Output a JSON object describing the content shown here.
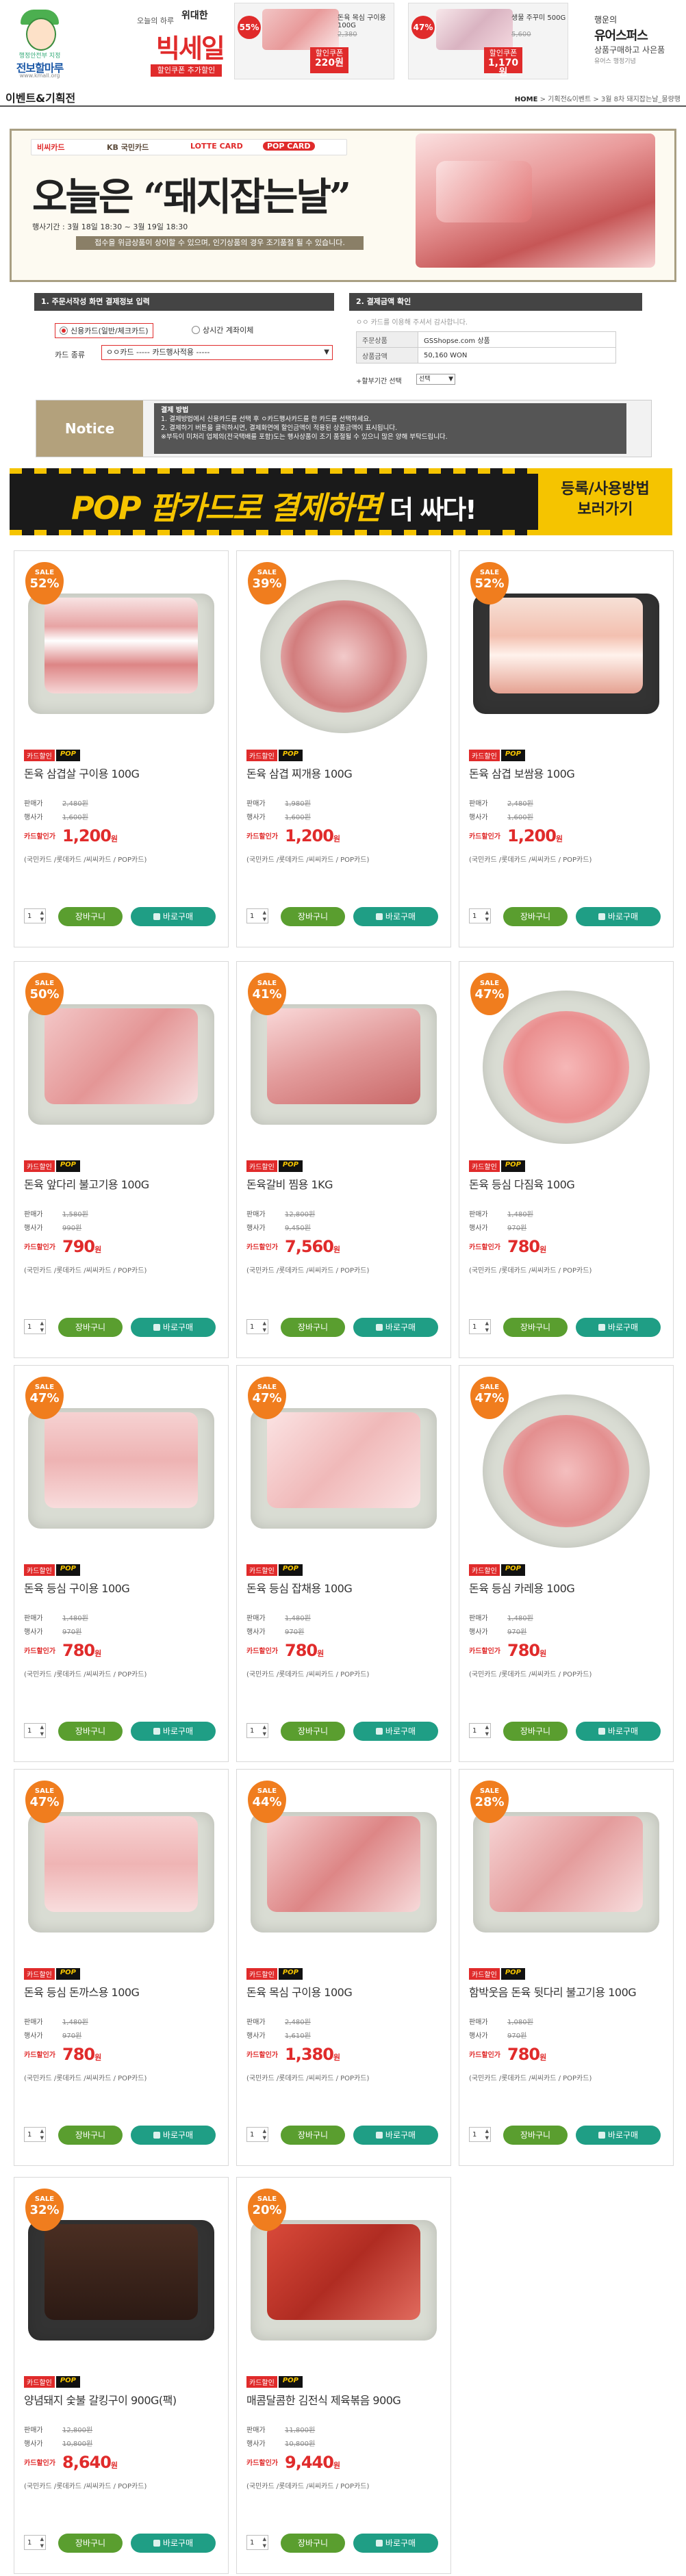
{
  "header": {
    "logo": {
      "tagline": "행정안전부 지정",
      "name": "전보할마루",
      "sub": "www.kmall.org"
    },
    "bigsale": {
      "title": "위대한",
      "small": "오늘의 하루",
      "big": "빅세일",
      "sub": "할인쿠폰 추가할인"
    },
    "promo1": {
      "pct": "55%",
      "name": "돈육 목심 구이용 100G",
      "was": "2,380",
      "price": "220원",
      "price_label": "할인쿠폰"
    },
    "promo2": {
      "pct": "47%",
      "name": "생물 주꾸미 500G",
      "was": "5,600",
      "price": "1,170원",
      "price_label": "할인쿠폰"
    },
    "lucky": {
      "l1": "행운의",
      "l2": "유어스퍼스",
      "l3": "상품구매하고 사은품",
      "l4": "유어스 행정기념"
    }
  },
  "title": {
    "text": "이벤트&기획전",
    "breadcrumb_home": "HOME",
    "breadcrumb_rest": " > 기획전&이벤트 > 3월 8차 돼지잡는날_물량행"
  },
  "event": {
    "cards": [
      "비씨카드",
      "KB 국민카드",
      "LOTTE CARD",
      "POP CARD"
    ],
    "headline_a": "오늘은 ",
    "headline_q1": "“",
    "headline_b": "돼지잡는날",
    "headline_q2": "”",
    "period": "행사기간 : 3월 18일 18:30 ~ 3월 19일 18:30",
    "warn": "접수을 위금상품이 상이할 수 있으며, 인기상품의 경우 조기품절 될 수 있습니다."
  },
  "pay": {
    "sec1": "1. 주문서작성 화면 결제정보 입력",
    "sec2": "2. 결제금액 확인",
    "radio1": "신용카드(일반/체크카드)",
    "radio2": "상시간 계좌이체",
    "card_label": "카드 종류",
    "card_value": "ㅇㅇ카드 ----- 카드행사적용 -----",
    "note": "ㅇㅇ 카드를 이용해 주셔서 감사합니다.",
    "rows": [
      {
        "h": "주문상품",
        "v": "GSShopse.com 상품"
      },
      {
        "h": "상품금액",
        "v": "50,160 WON"
      }
    ],
    "ins_label": "+할부기간 선택",
    "ins_value": "선택"
  },
  "notice": {
    "label": "Notice",
    "title": "결제 방법",
    "l1": "1. 결제방법에서 신용카드를 선택 후 ㅇ카드행사카드를 한 카드를 선택하세요.",
    "l2": "2. 결제하기 버튼을 클릭하시면, 결제화면에 할인금액이 적용된 상품금액이 표시됩니다.",
    "l3": "※부득이 미처리 업체의(전국택배를 포함)도는 행사상품이 조기 품절될 수 있으니 많은 양해 부탁드립니다."
  },
  "pop": {
    "txt": "POP 팝카드로 결제하면 ",
    "big": "더 싸다!",
    "right1": "등록/사용방법",
    "right2": "보러가기"
  },
  "labels": {
    "sale": "SALE",
    "card_sale": "카드할인",
    "pop": "POP",
    "retail": "판매가",
    "member": "행사가",
    "cardprice": "카드할인가",
    "cards": "(국민카드 /롯데카드 /씨씨카드 / POP카드)",
    "cart": "장바구니",
    "buy": "바로구매",
    "qty": "1",
    "won": "원"
  },
  "products": [
    {
      "pct": "52%",
      "name": "돈육 삼겹살 구이용 100G",
      "retail": "2,480원",
      "member": "1,600원",
      "card": "1,200"
    },
    {
      "pct": "39%",
      "name": "돈육 삼겹 찌개용 100G",
      "retail": "1,980원",
      "member": "1,600원",
      "card": "1,200"
    },
    {
      "pct": "52%",
      "name": "돈육 삼겹 보쌈용 100G",
      "retail": "2,480원",
      "member": "1,600원",
      "card": "1,200"
    },
    {
      "pct": "50%",
      "name": "돈육 앞다리 불고기용 100G",
      "retail": "1,580원",
      "member": "990원",
      "card": "790"
    },
    {
      "pct": "41%",
      "name": "돈육갈비 찜용 1KG",
      "retail": "12,800원",
      "member": "9,450원",
      "card": "7,560"
    },
    {
      "pct": "47%",
      "name": "돈육 등심 다짐육 100G",
      "retail": "1,480원",
      "member": "970원",
      "card": "780"
    },
    {
      "pct": "47%",
      "name": "돈육 등심 구이용 100G",
      "retail": "1,480원",
      "member": "970원",
      "card": "780"
    },
    {
      "pct": "47%",
      "name": "돈육 등심 잡채용 100G",
      "retail": "1,480원",
      "member": "970원",
      "card": "780"
    },
    {
      "pct": "47%",
      "name": "돈육 등심 카레용 100G",
      "retail": "1,480원",
      "member": "970원",
      "card": "780"
    },
    {
      "pct": "47%",
      "name": "돈육 등심 돈까스용 100G",
      "retail": "1,480원",
      "member": "970원",
      "card": "780"
    },
    {
      "pct": "44%",
      "name": "돈육 목심 구이용 100G",
      "retail": "2,480원",
      "member": "1,610원",
      "card": "1,380"
    },
    {
      "pct": "28%",
      "name": "함박웃음 돈육 뒷다리 불고기용 100G",
      "retail": "1,080원",
      "member": "970원",
      "card": "780"
    },
    {
      "pct": "32%",
      "name": "양념돼지 숯불 갈킹구이 900G(팩)",
      "retail": "12,800원",
      "member": "10,800원",
      "card": "8,640"
    },
    {
      "pct": "20%",
      "name": "매콤달콤한 김전식 제육볶음 900G",
      "retail": "11,800원",
      "member": "10,800원",
      "card": "9,440"
    }
  ],
  "colors": {
    "accent": "#e02b2b",
    "sale_badge": "#f07d1e",
    "cart_btn": "#5a9e2f",
    "buy_btn": "#1f9e85",
    "pop": "#f5c400"
  }
}
